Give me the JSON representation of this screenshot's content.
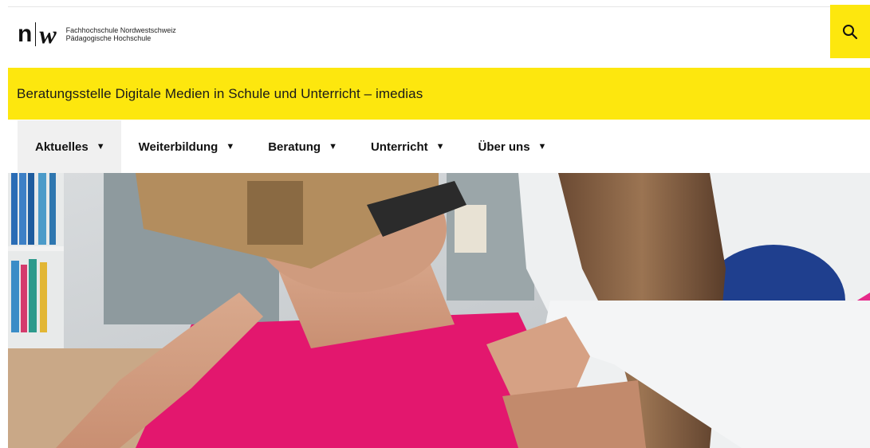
{
  "header": {
    "logo": {
      "mark_left": "n",
      "mark_right": "w",
      "line1": "Fachhochschule Nordwestschweiz",
      "line2": "Pädagogische Hochschule"
    },
    "search_icon": "search-icon"
  },
  "banner": {
    "title": "Beratungsstelle Digitale Medien in Schule und Unterricht – imedias"
  },
  "nav": {
    "items": [
      {
        "label": "Aktuelles",
        "active": true
      },
      {
        "label": "Weiterbildung",
        "active": false
      },
      {
        "label": "Beratung",
        "active": false
      },
      {
        "label": "Unterricht",
        "active": false
      },
      {
        "label": "Über uns",
        "active": false
      }
    ],
    "caret": "▼"
  },
  "colors": {
    "brand_yellow": "#fde70e",
    "active_nav_bg": "#f0f0f0",
    "text": "#111111"
  },
  "hero": {
    "description_icon": "hero-photo"
  }
}
